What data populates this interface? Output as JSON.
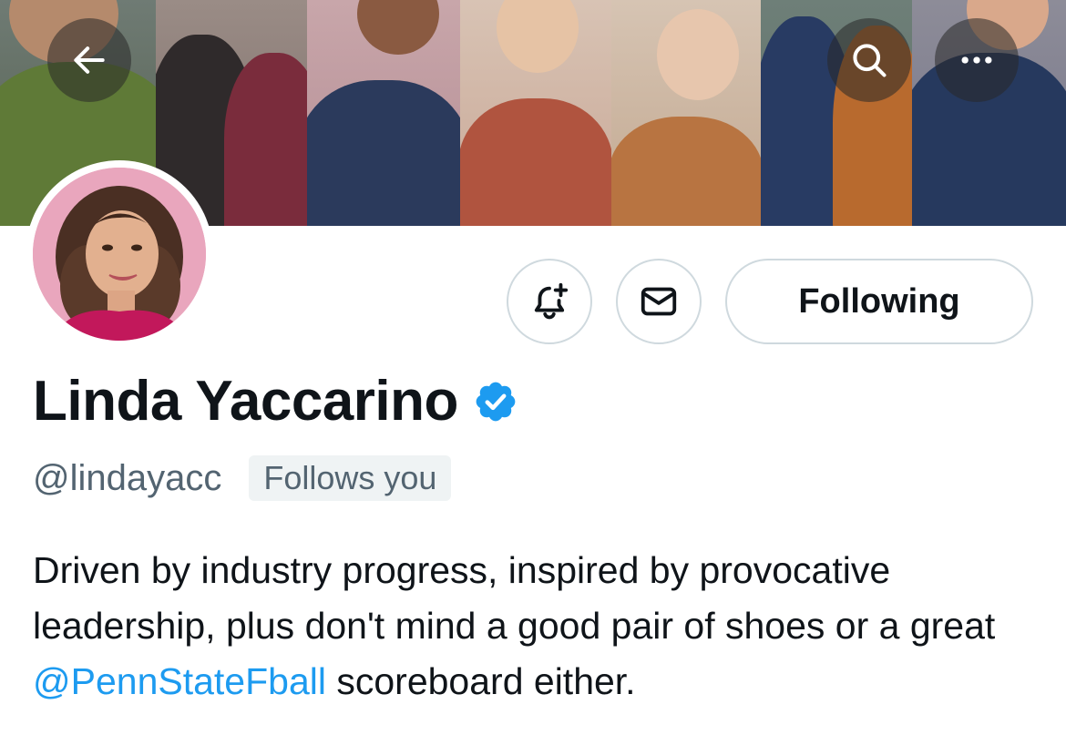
{
  "banner": {
    "back_icon": "arrow-left-icon",
    "search_icon": "search-icon",
    "more_icon": "more-horizontal-icon"
  },
  "profile": {
    "display_name": "Linda Yaccarino",
    "verified": true,
    "handle": "@lindayacc",
    "follows_you_label": "Follows you",
    "avatar_icon": "profile-photo"
  },
  "actions": {
    "notify_icon": "bell-plus-icon",
    "message_icon": "envelope-icon",
    "following_label": "Following"
  },
  "bio": {
    "text_before": "Driven by industry progress, inspired by provocative leadership, plus don't mind a good pair of shoes or a great ",
    "mention": "@PennStateFball",
    "text_after": " scoreboard either."
  },
  "colors": {
    "accent": "#1d9bf0",
    "text_primary": "#0f1419",
    "text_secondary": "#536471",
    "border": "#cfd9de",
    "chip_bg": "#eff3f4"
  }
}
